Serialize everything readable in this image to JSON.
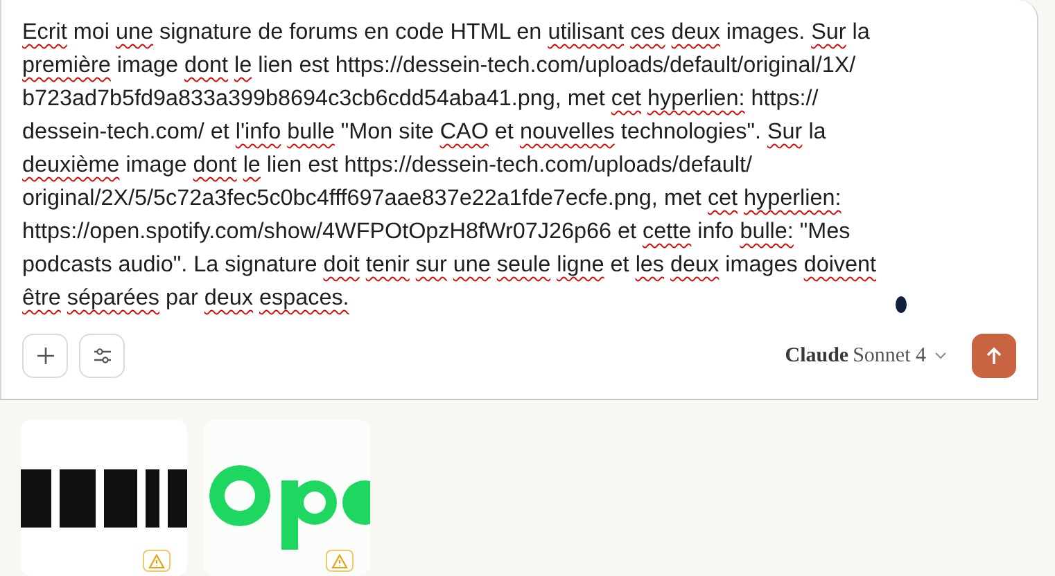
{
  "prompt": {
    "lines": [
      [
        {
          "text": "Ecrit",
          "misspelled": true
        },
        {
          "text": "moi",
          "misspelled": false
        },
        {
          "text": "une",
          "misspelled": true
        },
        {
          "text": "signature",
          "misspelled": false
        },
        {
          "text": "de",
          "misspelled": false
        },
        {
          "text": "forums",
          "misspelled": false
        },
        {
          "text": "en",
          "misspelled": false
        },
        {
          "text": "code",
          "misspelled": false
        },
        {
          "text": "HTML",
          "misspelled": false
        },
        {
          "text": "en",
          "misspelled": false
        },
        {
          "text": "utilisant",
          "misspelled": true
        },
        {
          "text": "ces",
          "misspelled": true
        },
        {
          "text": "deux",
          "misspelled": true
        },
        {
          "text": "images.",
          "misspelled": false
        },
        {
          "text": "Sur",
          "misspelled": true
        },
        {
          "text": "la",
          "misspelled": false
        }
      ],
      [
        {
          "text": "première",
          "misspelled": true
        },
        {
          "text": "image",
          "misspelled": false
        },
        {
          "text": "dont",
          "misspelled": true
        },
        {
          "text": "le",
          "misspelled": true
        },
        {
          "text": "lien",
          "misspelled": false
        },
        {
          "text": "est",
          "misspelled": false
        },
        {
          "text": "https://dessein-tech.com/uploads/default/original/1X/",
          "misspelled": false
        }
      ],
      [
        {
          "text": "b723ad7b5fd9a833a399b8694c3cb6cdd54aba41.png,",
          "misspelled": false
        },
        {
          "text": "met",
          "misspelled": false
        },
        {
          "text": "cet",
          "misspelled": true
        },
        {
          "text": "hyperlien:",
          "misspelled": true
        },
        {
          "text": "https://",
          "misspelled": false
        }
      ],
      [
        {
          "text": "dessein-tech.com/",
          "misspelled": false
        },
        {
          "text": "et",
          "misspelled": false
        },
        {
          "text": "l'info",
          "misspelled": true
        },
        {
          "text": "bulle",
          "misspelled": true
        },
        {
          "text": "\"Mon",
          "misspelled": false
        },
        {
          "text": "site",
          "misspelled": false
        },
        {
          "text": "CAO",
          "misspelled": true
        },
        {
          "text": "et",
          "misspelled": false
        },
        {
          "text": "nouvelles",
          "misspelled": true
        },
        {
          "text": "technologies\".",
          "misspelled": false
        },
        {
          "text": "Sur",
          "misspelled": true
        },
        {
          "text": "la",
          "misspelled": false
        }
      ],
      [
        {
          "text": "deuxième",
          "misspelled": true
        },
        {
          "text": "image",
          "misspelled": false
        },
        {
          "text": "dont",
          "misspelled": true
        },
        {
          "text": "le",
          "misspelled": true
        },
        {
          "text": "lien",
          "misspelled": false
        },
        {
          "text": "est",
          "misspelled": false
        },
        {
          "text": "https://dessein-tech.com/uploads/default/",
          "misspelled": false
        }
      ],
      [
        {
          "text": "original/2X/5/5c72a3fec5c0bc4fff697aae837e22a1fde7ecfe.png,",
          "misspelled": false
        },
        {
          "text": "met",
          "misspelled": false
        },
        {
          "text": "cet",
          "misspelled": true
        },
        {
          "text": "hyperlien:",
          "misspelled": true
        }
      ],
      [
        {
          "text": "https://open.spotify.com/show/4WFPOtOpzH8fWr07J26p66",
          "misspelled": false
        },
        {
          "text": "et",
          "misspelled": false
        },
        {
          "text": "cette",
          "misspelled": true
        },
        {
          "text": "info",
          "misspelled": false
        },
        {
          "text": "bulle:",
          "misspelled": true
        },
        {
          "text": "\"Mes",
          "misspelled": false
        }
      ],
      [
        {
          "text": "podcasts",
          "misspelled": false
        },
        {
          "text": "audio\".",
          "misspelled": false
        },
        {
          "text": "La",
          "misspelled": false
        },
        {
          "text": "signature",
          "misspelled": false
        },
        {
          "text": "doit",
          "misspelled": true
        },
        {
          "text": "tenir",
          "misspelled": true
        },
        {
          "text": "sur",
          "misspelled": true
        },
        {
          "text": "une",
          "misspelled": true
        },
        {
          "text": "seule",
          "misspelled": true
        },
        {
          "text": "ligne",
          "misspelled": true
        },
        {
          "text": "et",
          "misspelled": false
        },
        {
          "text": "les",
          "misspelled": true
        },
        {
          "text": "deux",
          "misspelled": true
        },
        {
          "text": "images",
          "misspelled": false
        },
        {
          "text": "doivent",
          "misspelled": true
        }
      ],
      [
        {
          "text": "être",
          "misspelled": true
        },
        {
          "text": "séparées",
          "misspelled": true
        },
        {
          "text": "par",
          "misspelled": false
        },
        {
          "text": "deux",
          "misspelled": true
        },
        {
          "text": "espaces.",
          "misspelled": true
        }
      ]
    ]
  },
  "model": {
    "brand": "Claude",
    "name": "Sonnet 4"
  },
  "attachments": [
    {
      "kind": "picture",
      "warning": true
    },
    {
      "kind": "picture",
      "warning": true
    }
  ]
}
